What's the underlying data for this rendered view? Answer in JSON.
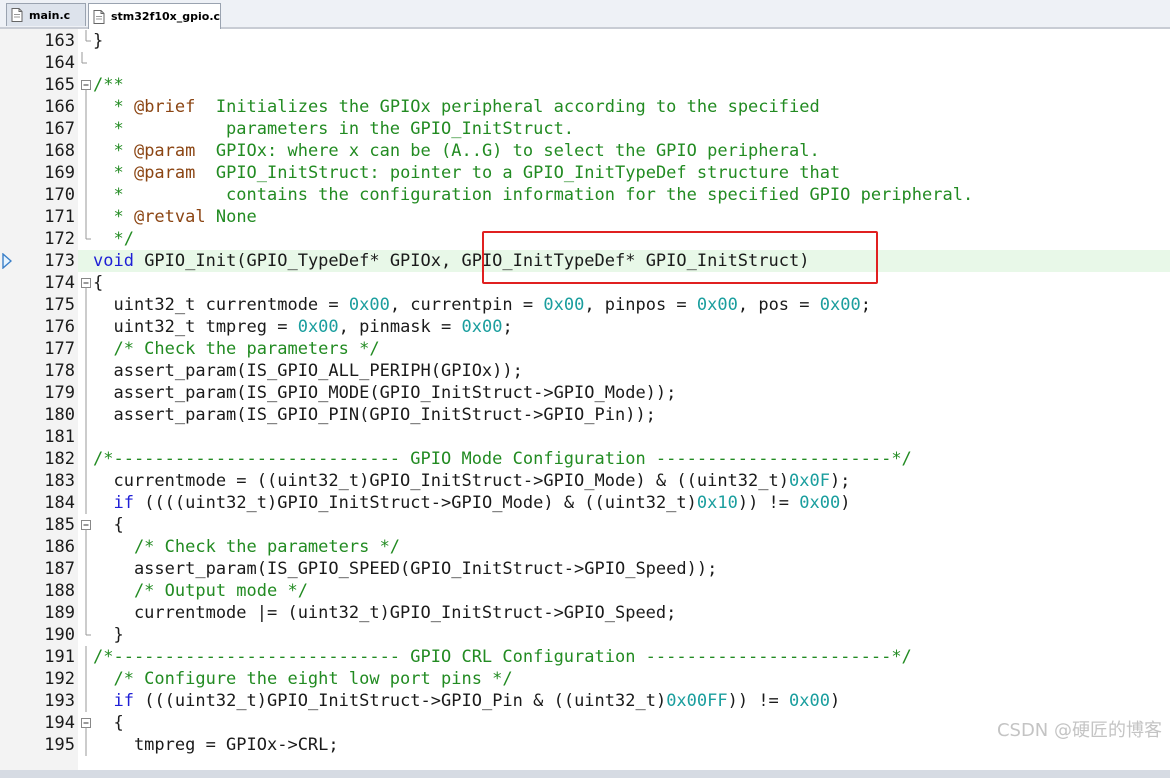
{
  "tabs": [
    {
      "label": "main.c",
      "active": false
    },
    {
      "label": "stm32f10x_gpio.c",
      "active": true
    }
  ],
  "colors": {
    "keyword": "#1f1fd6",
    "comment": "#228b22",
    "number": "#1a9e9e",
    "doc_tag": "#8b4513",
    "text": "#1a1a1a",
    "highlight_box": "#e02020",
    "current_line": "#e8f8e8"
  },
  "current_line_number": "173",
  "lines": [
    {
      "n": "163",
      "fold": "end",
      "segs": [
        [
          "t",
          "}"
        ]
      ]
    },
    {
      "n": "164",
      "fold": "end2",
      "segs": []
    },
    {
      "n": "165",
      "fold": "open",
      "segs": [
        [
          "c",
          "/**"
        ]
      ]
    },
    {
      "n": "166",
      "fold": "bar",
      "segs": [
        [
          "c",
          "  * "
        ],
        [
          "d",
          "@brief"
        ],
        [
          "c",
          "  Initializes the GPIOx peripheral according to the specified"
        ]
      ]
    },
    {
      "n": "167",
      "fold": "bar",
      "segs": [
        [
          "c",
          "  *          parameters in the GPIO_InitStruct."
        ]
      ]
    },
    {
      "n": "168",
      "fold": "bar",
      "segs": [
        [
          "c",
          "  * "
        ],
        [
          "d",
          "@param"
        ],
        [
          "c",
          "  GPIOx: where x can be (A..G) to select the GPIO peripheral."
        ]
      ]
    },
    {
      "n": "169",
      "fold": "bar",
      "segs": [
        [
          "c",
          "  * "
        ],
        [
          "d",
          "@param"
        ],
        [
          "c",
          "  GPIO_InitStruct: pointer to a GPIO_InitTypeDef structure that"
        ]
      ]
    },
    {
      "n": "170",
      "fold": "bar",
      "segs": [
        [
          "c",
          "  *          contains the configuration information for the specified GPIO peripheral."
        ]
      ]
    },
    {
      "n": "171",
      "fold": "bar",
      "segs": [
        [
          "c",
          "  * "
        ],
        [
          "d",
          "@retval"
        ],
        [
          "c",
          " None"
        ]
      ]
    },
    {
      "n": "172",
      "fold": "end",
      "segs": [
        [
          "c",
          "  */"
        ]
      ]
    },
    {
      "n": "173",
      "fold": "none",
      "segs": [
        [
          "k",
          "void"
        ],
        [
          "t",
          " GPIO_Init(GPIO_TypeDef* GPIOx, GPIO_InitTypeDef* GPIO_InitStruct)"
        ]
      ]
    },
    {
      "n": "174",
      "fold": "open",
      "segs": [
        [
          "t",
          "{"
        ]
      ]
    },
    {
      "n": "175",
      "fold": "bar",
      "segs": [
        [
          "t",
          "  uint32_t currentmode = "
        ],
        [
          "n",
          "0x00"
        ],
        [
          "t",
          ", currentpin = "
        ],
        [
          "n",
          "0x00"
        ],
        [
          "t",
          ", pinpos = "
        ],
        [
          "n",
          "0x00"
        ],
        [
          "t",
          ", pos = "
        ],
        [
          "n",
          "0x00"
        ],
        [
          "t",
          ";"
        ]
      ]
    },
    {
      "n": "176",
      "fold": "bar",
      "segs": [
        [
          "t",
          "  uint32_t tmpreg = "
        ],
        [
          "n",
          "0x00"
        ],
        [
          "t",
          ", pinmask = "
        ],
        [
          "n",
          "0x00"
        ],
        [
          "t",
          ";"
        ]
      ]
    },
    {
      "n": "177",
      "fold": "bar",
      "segs": [
        [
          "c",
          "  /* Check the parameters */"
        ]
      ]
    },
    {
      "n": "178",
      "fold": "bar",
      "segs": [
        [
          "t",
          "  assert_param(IS_GPIO_ALL_PERIPH(GPIOx));"
        ]
      ]
    },
    {
      "n": "179",
      "fold": "bar",
      "segs": [
        [
          "t",
          "  assert_param(IS_GPIO_MODE(GPIO_InitStruct->GPIO_Mode));"
        ]
      ]
    },
    {
      "n": "180",
      "fold": "bar",
      "segs": [
        [
          "t",
          "  assert_param(IS_GPIO_PIN(GPIO_InitStruct->GPIO_Pin));"
        ]
      ]
    },
    {
      "n": "181",
      "fold": "bar",
      "segs": []
    },
    {
      "n": "182",
      "fold": "bar",
      "segs": [
        [
          "c",
          "/*---------------------------- GPIO Mode Configuration -----------------------*/"
        ]
      ]
    },
    {
      "n": "183",
      "fold": "bar",
      "segs": [
        [
          "t",
          "  currentmode = ((uint32_t)GPIO_InitStruct->GPIO_Mode) & ((uint32_t)"
        ],
        [
          "n",
          "0x0F"
        ],
        [
          "t",
          ");"
        ]
      ]
    },
    {
      "n": "184",
      "fold": "bar",
      "segs": [
        [
          "t",
          "  "
        ],
        [
          "k",
          "if"
        ],
        [
          "t",
          " ((((uint32_t)GPIO_InitStruct->GPIO_Mode) & ((uint32_t)"
        ],
        [
          "n",
          "0x10"
        ],
        [
          "t",
          ")) != "
        ],
        [
          "n",
          "0x00"
        ],
        [
          "t",
          ")"
        ]
      ]
    },
    {
      "n": "185",
      "fold": "open",
      "segs": [
        [
          "t",
          "  {"
        ]
      ]
    },
    {
      "n": "186",
      "fold": "bar",
      "segs": [
        [
          "c",
          "    /* Check the parameters */"
        ]
      ]
    },
    {
      "n": "187",
      "fold": "bar",
      "segs": [
        [
          "t",
          "    assert_param(IS_GPIO_SPEED(GPIO_InitStruct->GPIO_Speed));"
        ]
      ]
    },
    {
      "n": "188",
      "fold": "bar",
      "segs": [
        [
          "c",
          "    /* Output mode */"
        ]
      ]
    },
    {
      "n": "189",
      "fold": "bar",
      "segs": [
        [
          "t",
          "    currentmode |= (uint32_t)GPIO_InitStruct->GPIO_Speed;"
        ]
      ]
    },
    {
      "n": "190",
      "fold": "end",
      "segs": [
        [
          "t",
          "  }"
        ]
      ]
    },
    {
      "n": "191",
      "fold": "bar",
      "segs": [
        [
          "c",
          "/*---------------------------- GPIO CRL Configuration ------------------------*/"
        ]
      ]
    },
    {
      "n": "192",
      "fold": "bar",
      "segs": [
        [
          "c",
          "  /* Configure the eight low port pins */"
        ]
      ]
    },
    {
      "n": "193",
      "fold": "bar",
      "segs": [
        [
          "t",
          "  "
        ],
        [
          "k",
          "if"
        ],
        [
          "t",
          " (((uint32_t)GPIO_InitStruct->GPIO_Pin & ((uint32_t)"
        ],
        [
          "n",
          "0x00FF"
        ],
        [
          "t",
          ")) != "
        ],
        [
          "n",
          "0x00"
        ],
        [
          "t",
          ")"
        ]
      ]
    },
    {
      "n": "194",
      "fold": "open",
      "segs": [
        [
          "t",
          "  {"
        ]
      ]
    },
    {
      "n": "195",
      "fold": "bar",
      "segs": [
        [
          "t",
          "    tmpreg = GPIOx->CRL;"
        ]
      ]
    }
  ],
  "watermark": "CSDN @硬匠的博客"
}
